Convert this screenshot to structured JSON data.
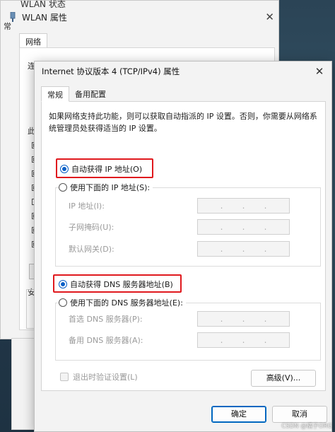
{
  "back_window": {
    "title_cut": "WLAN 状态",
    "title": "WLAN 属性",
    "close_glyph": "✕",
    "tab": "网络",
    "frag_lian": "连",
    "frag_ci": "此",
    "frag_an": "安",
    "frag_side": "常"
  },
  "dialog": {
    "title": "Internet 协议版本 4 (TCP/IPv4) 属性",
    "close_glyph": "✕",
    "tabs": [
      {
        "label": "常规",
        "active": true
      },
      {
        "label": "备用配置",
        "active": false
      }
    ],
    "description": "如果网络支持此功能，则可以获取自动指派的 IP 设置。否则，你需要从网络系统管理员处获得适当的 IP 设置。",
    "ip_auto": {
      "label": "自动获得 IP 地址(O)",
      "checked": true
    },
    "ip_manual": {
      "label": "使用下面的 IP 地址(S):",
      "checked": false
    },
    "ip_fields": [
      {
        "label": "IP 地址(I):"
      },
      {
        "label": "子网掩码(U):"
      },
      {
        "label": "默认网关(D):"
      }
    ],
    "dns_auto": {
      "label": "自动获得 DNS 服务器地址(B)",
      "checked": true
    },
    "dns_manual": {
      "label": "使用下面的 DNS 服务器地址(E):",
      "checked": false
    },
    "dns_fields": [
      {
        "label": "首选 DNS 服务器(P):"
      },
      {
        "label": "备用 DNS 服务器(A):"
      }
    ],
    "ip_dot": ".",
    "validate_label": "退出时验证设置(L)",
    "advanced_label": "高级(V)...",
    "ok_label": "确定",
    "cancel_label": "取消"
  },
  "watermark": "CSDN @橘子ORG",
  "colors": {
    "highlight_red": "#e0191e",
    "radio_blue": "#0a5fc6",
    "primary_border": "#0067c0"
  }
}
